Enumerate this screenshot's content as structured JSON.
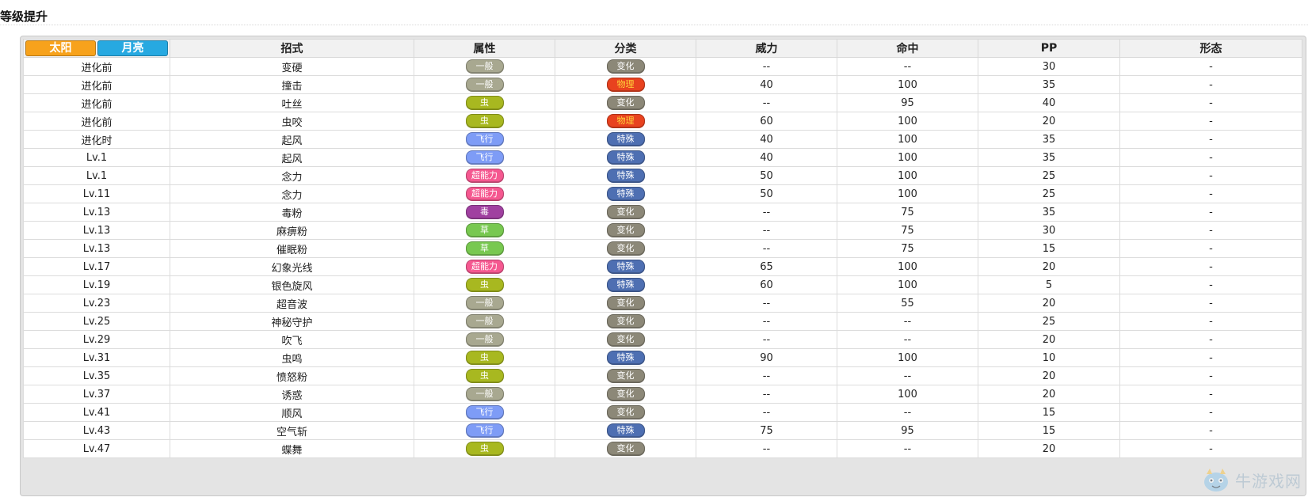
{
  "heading": "等级提升",
  "versions": [
    {
      "label": "太阳",
      "color": "#f7a21c"
    },
    {
      "label": "月亮",
      "color": "#27a9e1"
    }
  ],
  "columns": {
    "move": "招式",
    "type": "属性",
    "category": "分类",
    "power": "威力",
    "accuracy": "命中",
    "pp": "PP",
    "form": "形态"
  },
  "type_colors": {
    "一般": "#a8a890",
    "虫": "#a8b820",
    "飞行": "#7e9cf6",
    "超能力": "#f55890",
    "毒": "#a040a0",
    "草": "#78c850"
  },
  "category_colors": {
    "变化": "#8c8878",
    "物理": "#e8421f",
    "特殊": "#4e6fb2"
  },
  "rows": [
    {
      "level": "进化前",
      "move": "变硬",
      "type": "一般",
      "category": "变化",
      "power": "--",
      "accuracy": "--",
      "pp": "30",
      "form": "-"
    },
    {
      "level": "进化前",
      "move": "撞击",
      "type": "一般",
      "category": "物理",
      "power": "40",
      "accuracy": "100",
      "pp": "35",
      "form": "-"
    },
    {
      "level": "进化前",
      "move": "吐丝",
      "type": "虫",
      "category": "变化",
      "power": "--",
      "accuracy": "95",
      "pp": "40",
      "form": "-"
    },
    {
      "level": "进化前",
      "move": "虫咬",
      "type": "虫",
      "category": "物理",
      "power": "60",
      "accuracy": "100",
      "pp": "20",
      "form": "-"
    },
    {
      "level": "进化时",
      "move": "起风",
      "type": "飞行",
      "category": "特殊",
      "power": "40",
      "accuracy": "100",
      "pp": "35",
      "form": "-"
    },
    {
      "level": "Lv.1",
      "move": "起风",
      "type": "飞行",
      "category": "特殊",
      "power": "40",
      "accuracy": "100",
      "pp": "35",
      "form": "-"
    },
    {
      "level": "Lv.1",
      "move": "念力",
      "type": "超能力",
      "category": "特殊",
      "power": "50",
      "accuracy": "100",
      "pp": "25",
      "form": "-"
    },
    {
      "level": "Lv.11",
      "move": "念力",
      "type": "超能力",
      "category": "特殊",
      "power": "50",
      "accuracy": "100",
      "pp": "25",
      "form": "-"
    },
    {
      "level": "Lv.13",
      "move": "毒粉",
      "type": "毒",
      "category": "变化",
      "power": "--",
      "accuracy": "75",
      "pp": "35",
      "form": "-"
    },
    {
      "level": "Lv.13",
      "move": "麻痹粉",
      "type": "草",
      "category": "变化",
      "power": "--",
      "accuracy": "75",
      "pp": "30",
      "form": "-"
    },
    {
      "level": "Lv.13",
      "move": "催眠粉",
      "type": "草",
      "category": "变化",
      "power": "--",
      "accuracy": "75",
      "pp": "15",
      "form": "-"
    },
    {
      "level": "Lv.17",
      "move": "幻象光线",
      "type": "超能力",
      "category": "特殊",
      "power": "65",
      "accuracy": "100",
      "pp": "20",
      "form": "-"
    },
    {
      "level": "Lv.19",
      "move": "银色旋风",
      "type": "虫",
      "category": "特殊",
      "power": "60",
      "accuracy": "100",
      "pp": "5",
      "form": "-"
    },
    {
      "level": "Lv.23",
      "move": "超音波",
      "type": "一般",
      "category": "变化",
      "power": "--",
      "accuracy": "55",
      "pp": "20",
      "form": "-"
    },
    {
      "level": "Lv.25",
      "move": "神秘守护",
      "type": "一般",
      "category": "变化",
      "power": "--",
      "accuracy": "--",
      "pp": "25",
      "form": "-"
    },
    {
      "level": "Lv.29",
      "move": "吹飞",
      "type": "一般",
      "category": "变化",
      "power": "--",
      "accuracy": "--",
      "pp": "20",
      "form": "-"
    },
    {
      "level": "Lv.31",
      "move": "虫鸣",
      "type": "虫",
      "category": "特殊",
      "power": "90",
      "accuracy": "100",
      "pp": "10",
      "form": "-"
    },
    {
      "level": "Lv.35",
      "move": "愤怒粉",
      "type": "虫",
      "category": "变化",
      "power": "--",
      "accuracy": "--",
      "pp": "20",
      "form": "-"
    },
    {
      "level": "Lv.37",
      "move": "诱惑",
      "type": "一般",
      "category": "变化",
      "power": "--",
      "accuracy": "100",
      "pp": "20",
      "form": "-"
    },
    {
      "level": "Lv.41",
      "move": "顺风",
      "type": "飞行",
      "category": "变化",
      "power": "--",
      "accuracy": "--",
      "pp": "15",
      "form": "-"
    },
    {
      "level": "Lv.43",
      "move": "空气斩",
      "type": "飞行",
      "category": "特殊",
      "power": "75",
      "accuracy": "95",
      "pp": "15",
      "form": "-"
    },
    {
      "level": "Lv.47",
      "move": "蝶舞",
      "type": "虫",
      "category": "变化",
      "power": "--",
      "accuracy": "--",
      "pp": "20",
      "form": "-"
    }
  ],
  "watermark": {
    "text": "牛游戏网",
    "icon": "mascot-icon"
  }
}
